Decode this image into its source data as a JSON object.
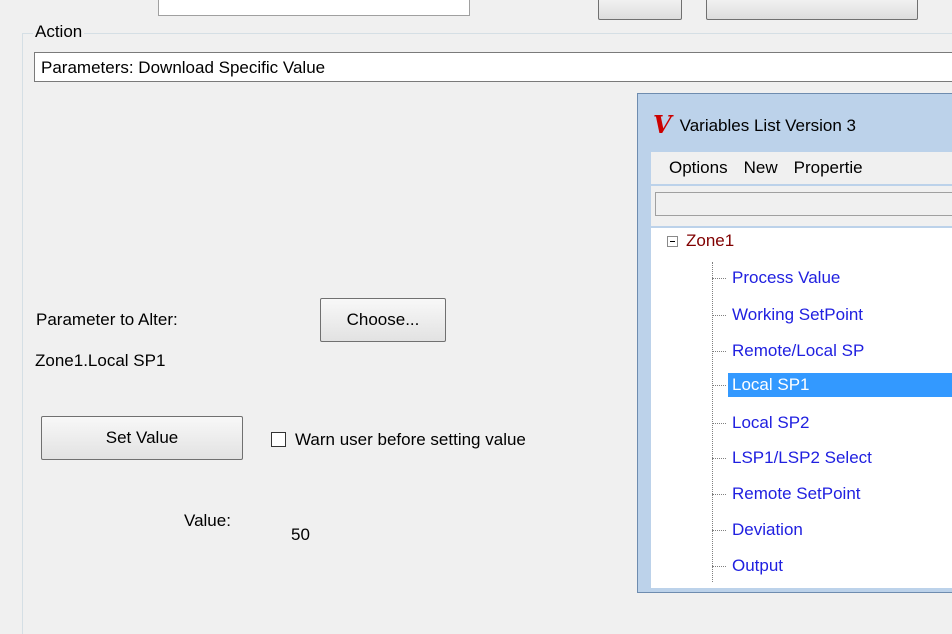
{
  "action_group": {
    "legend": "Action",
    "field_value": "Parameters: Download Specific Value"
  },
  "parameter": {
    "label": "Parameter to Alter:",
    "choose_button": "Choose...",
    "selected": "Zone1.Local SP1"
  },
  "set_value": {
    "button": "Set Value",
    "warn_label": "Warn user before setting value",
    "warn_checked": false,
    "value_label": "Value:",
    "value": "50"
  },
  "variables_window": {
    "logo": "V",
    "title": "Variables List Version 3",
    "menu": [
      "Options",
      "New",
      "Propertie"
    ],
    "tree": {
      "root": "Zone1",
      "items": [
        "Process Value",
        "Working SetPoint",
        "Remote/Local SP",
        "Local SP1",
        "Local SP2",
        "LSP1/LSP2 Select",
        "Remote SetPoint",
        "Deviation",
        "Output"
      ],
      "selected": "Local SP1"
    }
  }
}
